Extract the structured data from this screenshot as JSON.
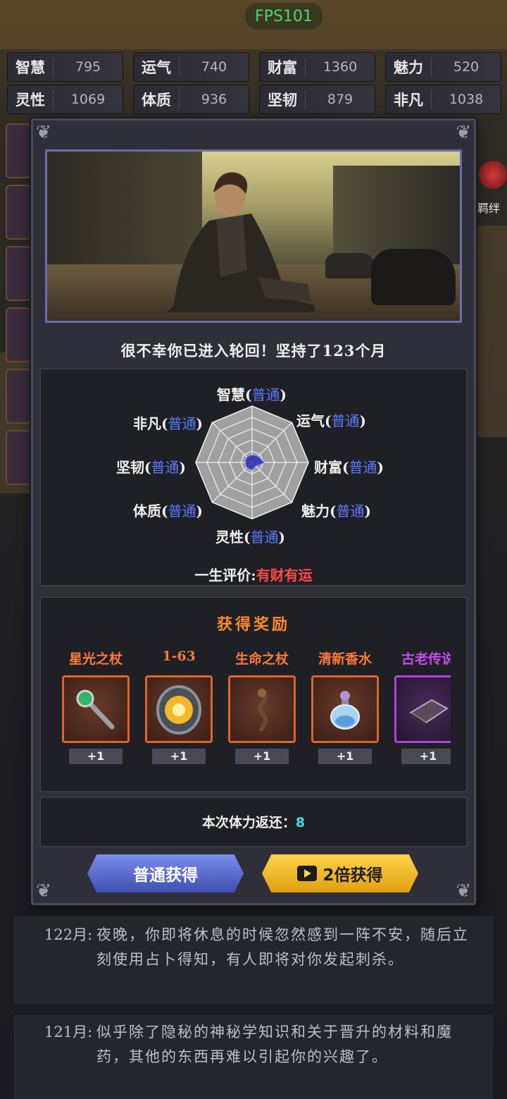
{
  "fps": "FPS101",
  "stats": [
    {
      "label": "智慧",
      "value": "795"
    },
    {
      "label": "运气",
      "value": "740"
    },
    {
      "label": "财富",
      "value": "1360"
    },
    {
      "label": "魅力",
      "value": "520"
    },
    {
      "label": "灵性",
      "value": "1069"
    },
    {
      "label": "体质",
      "value": "936"
    },
    {
      "label": "坚韧",
      "value": "879"
    },
    {
      "label": "非凡",
      "value": "1038"
    }
  ],
  "side_right_label": "羁绊",
  "dialog": {
    "message": "很不幸你已进入轮回！坚持了123个月",
    "radar": {
      "attributes": [
        {
          "name": "智慧",
          "quality": "普通",
          "level": 0.12
        },
        {
          "name": "运气",
          "quality": "普通",
          "level": 0.14
        },
        {
          "name": "财富",
          "quality": "普通",
          "level": 0.2
        },
        {
          "name": "魅力",
          "quality": "普通",
          "level": 0.08
        },
        {
          "name": "灵性",
          "quality": "普通",
          "level": 0.12
        },
        {
          "name": "体质",
          "quality": "普通",
          "level": 0.12
        },
        {
          "name": "坚韧",
          "quality": "普通",
          "level": 0.11
        },
        {
          "name": "非凡",
          "quality": "普通",
          "level": 0.12
        }
      ],
      "grid_color": "#8a8a8a",
      "fill_color": "#2a2aa8"
    },
    "evaluation_label": "一生评价:",
    "evaluation_value": "有财有运",
    "reward_title": "获得奖励",
    "rewards": [
      {
        "name": "星光之杖",
        "count": "+1",
        "name_color": "#ff7a38",
        "icon": "staff-gem-icon"
      },
      {
        "name": "1-63",
        "count": "+1",
        "name_color": "#ff7a38",
        "icon": "golden-rune-icon"
      },
      {
        "name": "生命之杖",
        "count": "+1",
        "name_color": "#ff7a38",
        "icon": "twisted-staff-icon"
      },
      {
        "name": "清新香水",
        "count": "+1",
        "name_color": "#ff7a38",
        "icon": "perfume-bottle-icon"
      },
      {
        "name": "古老传说",
        "count": "+1",
        "name_color": "#c84cf0",
        "icon": "ancient-book-icon"
      }
    ],
    "stamina_label": "本次体力返还：",
    "stamina_value": "8",
    "btn_normal": "普通获得",
    "btn_double": "2倍获得"
  },
  "logs": [
    {
      "time": "122月:",
      "text": "夜晚，你即将休息的时候忽然感到一阵不安，随后立刻使用占卜得知，有人即将对你发起刺杀。"
    },
    {
      "time": "121月:",
      "text": "似乎除了隐秘的神秘学知识和关于晋升的材料和魔药，其他的东西再难以引起你的兴趣了。"
    }
  ]
}
